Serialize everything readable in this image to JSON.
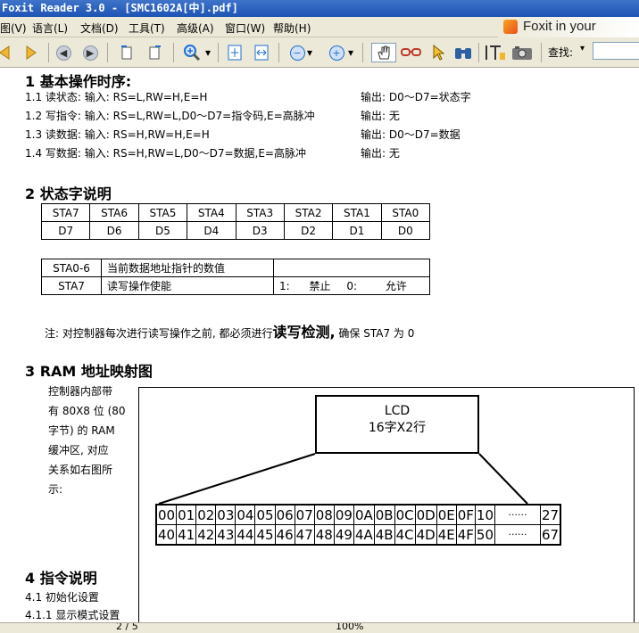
{
  "window": {
    "title": "Foxit Reader 3.0 - [SMC1602A[中].pdf]"
  },
  "menu": [
    "图(V)",
    "语言(L)",
    "文档(D)",
    "工具(T)",
    "高级(A)",
    "窗口(W)",
    "帮助(H)"
  ],
  "brand": "Foxit in your",
  "toolbar": {
    "find_label": "查找:"
  },
  "content": {
    "sec1_title": "1 基本操作时序:",
    "sec1_rows": [
      {
        "left": "1.1 读状态: 输入: RS=L,RW=H,E=H",
        "right": "输出: D0～D7=状态字"
      },
      {
        "left": "1.2 写指令: 输入: RS=L,RW=L,D0～D7=指令码,E=高脉冲",
        "right": "输出: 无"
      },
      {
        "left": "1.3 读数据: 输入: RS=H,RW=H,E=H",
        "right": "输出: D0～D7=数据"
      },
      {
        "left": "1.4 写数据: 输入: RS=H,RW=L,D0～D7=数据,E=高脉冲",
        "right": "输出: 无"
      }
    ],
    "sec2_title": "2 状态字说明",
    "sta_row": [
      "STA7",
      "STA6",
      "STA5",
      "STA4",
      "STA3",
      "STA2",
      "STA1",
      "STA0"
    ],
    "d_row": [
      "D7",
      "D6",
      "D5",
      "D4",
      "D3",
      "D2",
      "D1",
      "D0"
    ],
    "desc_table": {
      "r1c1": "STA0-6",
      "r1c2": "当前数据地址指针的数值",
      "r1c3": "",
      "r2c1": "STA7",
      "r2c2": "读写操作使能",
      "r2c3a": "1:",
      "r2c3b": "禁止",
      "r2c3c": "0:",
      "r2c3d": "允许"
    },
    "note_prefix": "注: 对控制器每次进行读写操作之前, 都必须进行",
    "note_bold": "读写检测,",
    "note_suffix": "确保 STA7 为 0",
    "sec3_title": "3 RAM 地址映射图",
    "sec3_side": [
      "控制器内部带",
      "有 80X8 位 (80",
      "字节) 的 RAM",
      "缓冲区, 对应",
      "关系如右图所",
      "示:"
    ],
    "lcd_line1": "LCD",
    "lcd_line2": "16字X2行",
    "ram_row1": [
      "00",
      "01",
      "02",
      "03",
      "04",
      "05",
      "06",
      "07",
      "08",
      "09",
      "0A",
      "0B",
      "0C",
      "0D",
      "0E",
      "0F",
      "10",
      "······",
      "27"
    ],
    "ram_row2": [
      "40",
      "41",
      "42",
      "43",
      "44",
      "45",
      "46",
      "47",
      "48",
      "49",
      "4A",
      "4B",
      "4C",
      "4D",
      "4E",
      "4F",
      "50",
      "······",
      "67"
    ],
    "sec4_title": "4 指令说明",
    "sec41": "4.1 初始化设置",
    "sec411": "4.1.1  显示模式设置"
  },
  "status": {
    "page": "2 / 5",
    "zoom": "100%"
  }
}
